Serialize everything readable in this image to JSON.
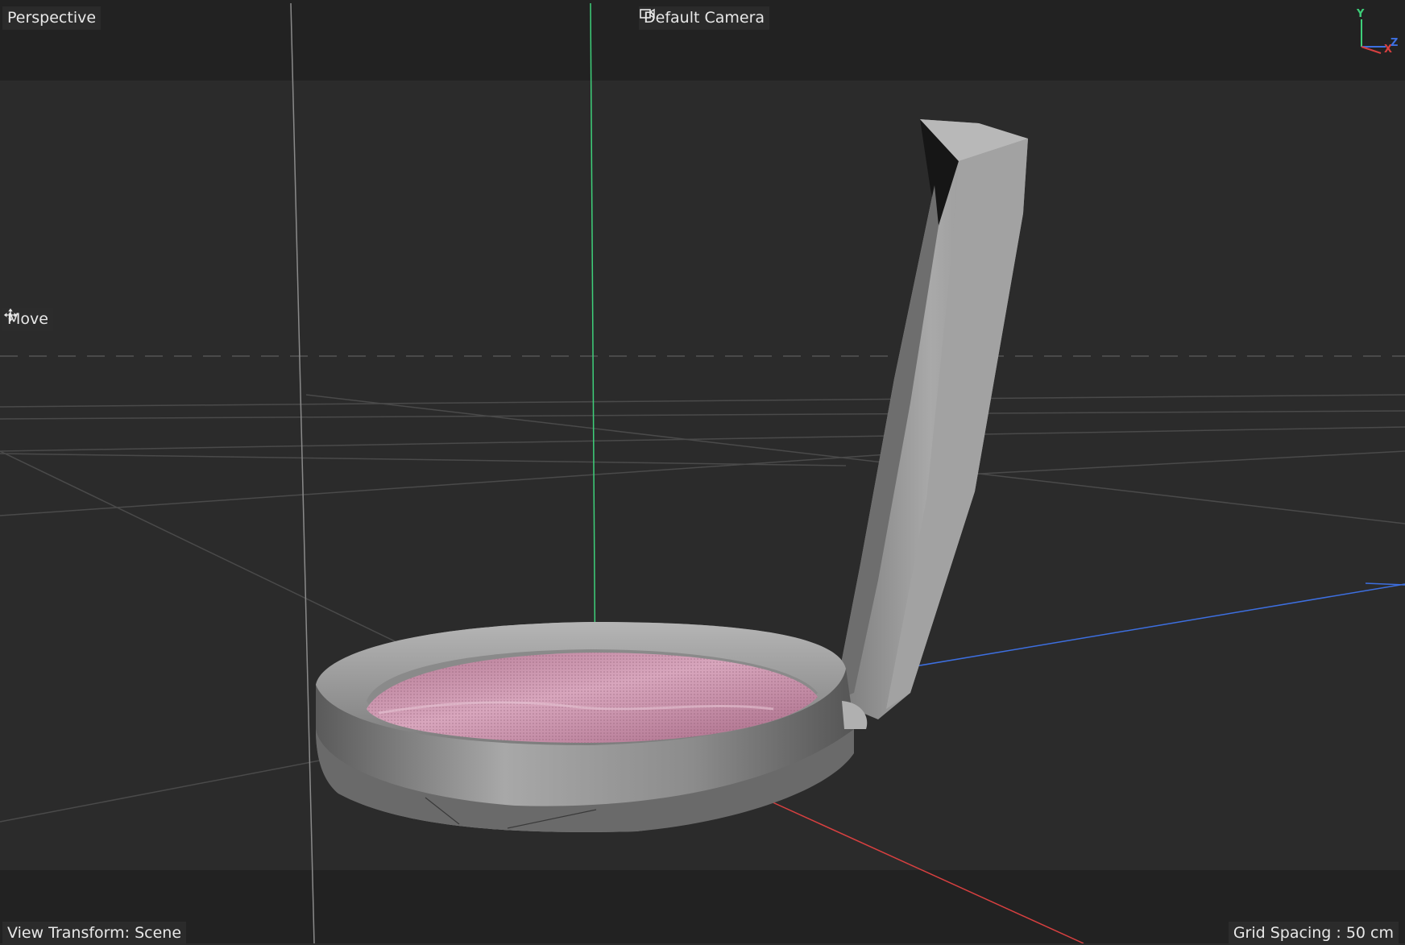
{
  "viewport": {
    "view_name": "Perspective",
    "camera": "Default Camera",
    "camera_icon": "camera-icon",
    "tool": "Move",
    "tool_icon": "move-arrows-icon",
    "view_transform": "View Transform: Scene",
    "grid_spacing": "Grid Spacing : 50 cm"
  },
  "axis_gizmo": {
    "y": "Y",
    "x": "X",
    "z": "Z"
  },
  "colors": {
    "background": "#2b2b2b",
    "letterbox": "#222222",
    "axis_x": "#d84040",
    "axis_y": "#3ed07a",
    "axis_z": "#3d6fe0",
    "grid": "#4a4a4a",
    "compact_shell": "#9a9a9a",
    "powder": "#c98ea6"
  }
}
